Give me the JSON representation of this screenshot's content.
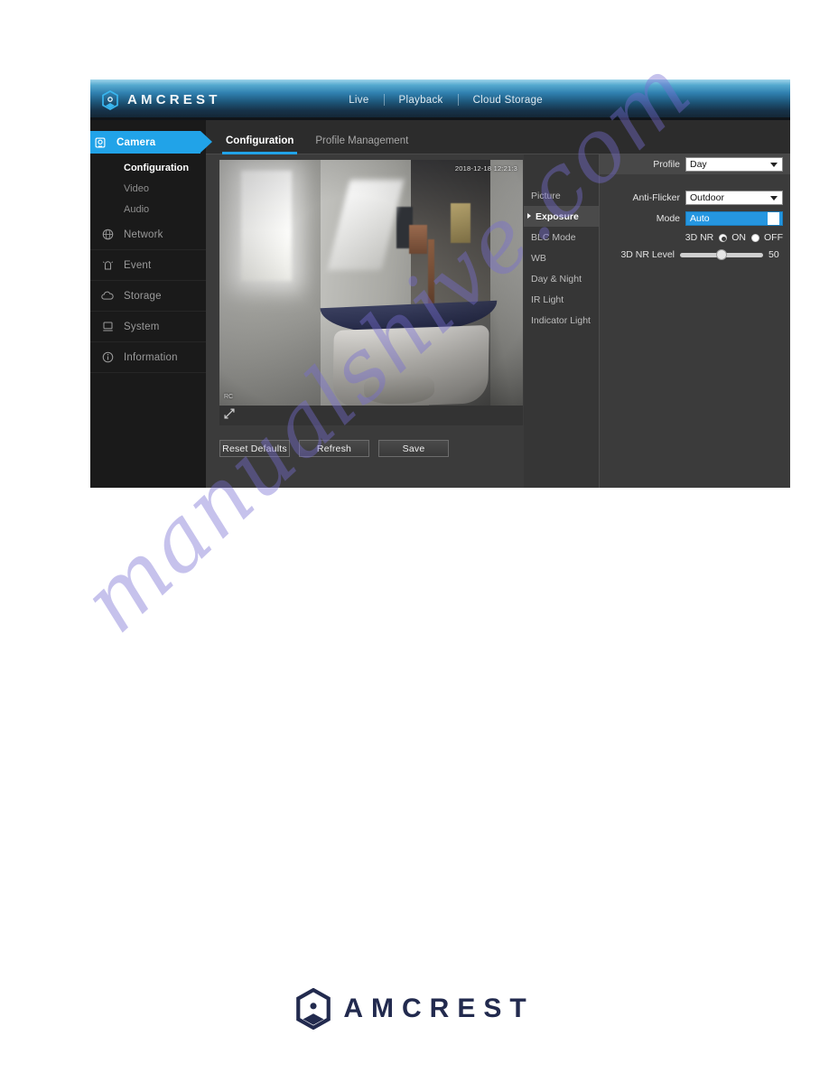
{
  "header": {
    "brand": "AMCREST",
    "brand_icon": "amcrest-hex-logo-icon",
    "nav": [
      {
        "label": "Live"
      },
      {
        "label": "Playback"
      },
      {
        "label": "Cloud Storage"
      }
    ]
  },
  "sidebar": {
    "items": [
      {
        "label": "Camera",
        "icon": "camera-icon",
        "active": true
      },
      {
        "label": "Network",
        "icon": "globe-icon",
        "active": false
      },
      {
        "label": "Event",
        "icon": "alarm-bell-icon",
        "active": false
      },
      {
        "label": "Storage",
        "icon": "cloud-icon",
        "active": false
      },
      {
        "label": "System",
        "icon": "monitor-icon",
        "active": false
      },
      {
        "label": "Information",
        "icon": "info-circle-icon",
        "active": false
      }
    ],
    "subitems": [
      {
        "label": "Configuration",
        "active": true
      },
      {
        "label": "Video",
        "active": false
      },
      {
        "label": "Audio",
        "active": false
      }
    ]
  },
  "tabs": [
    {
      "label": "Configuration",
      "active": true
    },
    {
      "label": "Profile Management",
      "active": false
    }
  ],
  "video": {
    "timestamp": "2018-12-18 12:21:3",
    "channel_label": "RC",
    "expand_icon": "expand-arrows-icon"
  },
  "buttons": [
    {
      "label": "Reset Defaults"
    },
    {
      "label": "Refresh"
    },
    {
      "label": "Save"
    }
  ],
  "subtabs": [
    {
      "label": "Picture",
      "active": false
    },
    {
      "label": "Exposure",
      "active": true
    },
    {
      "label": "BLC Mode",
      "active": false
    },
    {
      "label": "WB",
      "active": false
    },
    {
      "label": "Day & Night",
      "active": false
    },
    {
      "label": "IR Light",
      "active": false
    },
    {
      "label": "Indicator Light",
      "active": false
    }
  ],
  "settings": {
    "profile": {
      "label": "Profile",
      "value": "Day"
    },
    "anti_flicker": {
      "label": "Anti-Flicker",
      "value": "Outdoor"
    },
    "mode": {
      "label": "Mode",
      "value": "Auto"
    },
    "nr3d": {
      "label": "3D NR",
      "on_label": "ON",
      "off_label": "OFF",
      "selected": "ON"
    },
    "nr3d_level": {
      "label": "3D NR Level",
      "value": "50"
    }
  },
  "footer": {
    "brand": "AMCREST",
    "brand_icon": "amcrest-hex-logo-icon"
  },
  "watermark": {
    "text": "manualshive.com"
  },
  "colors": {
    "accent": "#21a3e8",
    "select_highlight": "#2596e0",
    "panel_bg": "#3b3b3b",
    "sidebar_bg": "#1a1a1a",
    "footer_brand": "#222a4e"
  }
}
